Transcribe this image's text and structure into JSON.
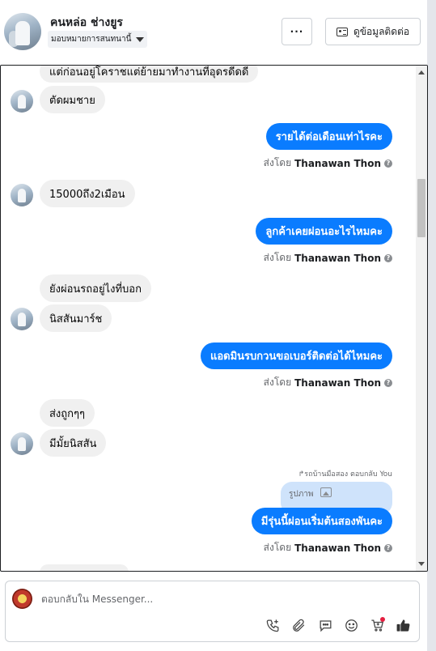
{
  "header": {
    "contact_name": "คนหล่อ ช่างยูร",
    "assign_label": "มอบหมายการสนทนานี้",
    "more_label": "···",
    "view_contact_label": "ดูข้อมูลติดต่อ"
  },
  "conversation": {
    "partial_top_text": "แต่ก่อนอยู่โคราชแต่ย้ายมาทำงานที่อุดรดีดดี",
    "sender_prefix": "ส่งโดย",
    "sender_name": "Thanawan Thon",
    "messages": [
      {
        "dir": "in",
        "text": "ตัดผมชาย"
      },
      {
        "dir": "out",
        "text": "รายได้ต่อเดือนเท่าไรคะ"
      },
      {
        "dir": "in",
        "text": "15000ถึง2เมือน"
      },
      {
        "dir": "out",
        "text": "ลูกค้าเคยผ่อนอะไรไหมคะ"
      },
      {
        "dir": "in",
        "text": "ยังผ่อนรถอยู่ไงที่บอก"
      },
      {
        "dir": "in",
        "text": "นิสสันมาร์ช"
      },
      {
        "dir": "out",
        "text": "แอดมินรบกวนขอเบอร์ติดต่อได้ไหมคะ"
      },
      {
        "dir": "in",
        "text": "ส่งถูกๆๆ"
      },
      {
        "dir": "in",
        "text": "มีมั้ยนิสสัน"
      },
      {
        "dir": "out",
        "text": "มีรุ่นนี้ผ่อนเริ่มต้นสองพันคะ"
      }
    ],
    "reply_note": "↱รถบ้านมือสอง ตอบกลับ You",
    "reply_preview": "รูปภาพ"
  },
  "composer": {
    "placeholder": "ตอบกลับใน Messenger...",
    "tools": [
      "phone-add-icon",
      "attachment-icon",
      "saved-replies-icon",
      "emoji-icon",
      "cart-icon",
      "like-icon"
    ]
  },
  "colors": {
    "outgoing_bubble": "#0a7cff",
    "incoming_bubble": "#f0f0f0",
    "reply_bubble": "#cfe3fb"
  }
}
